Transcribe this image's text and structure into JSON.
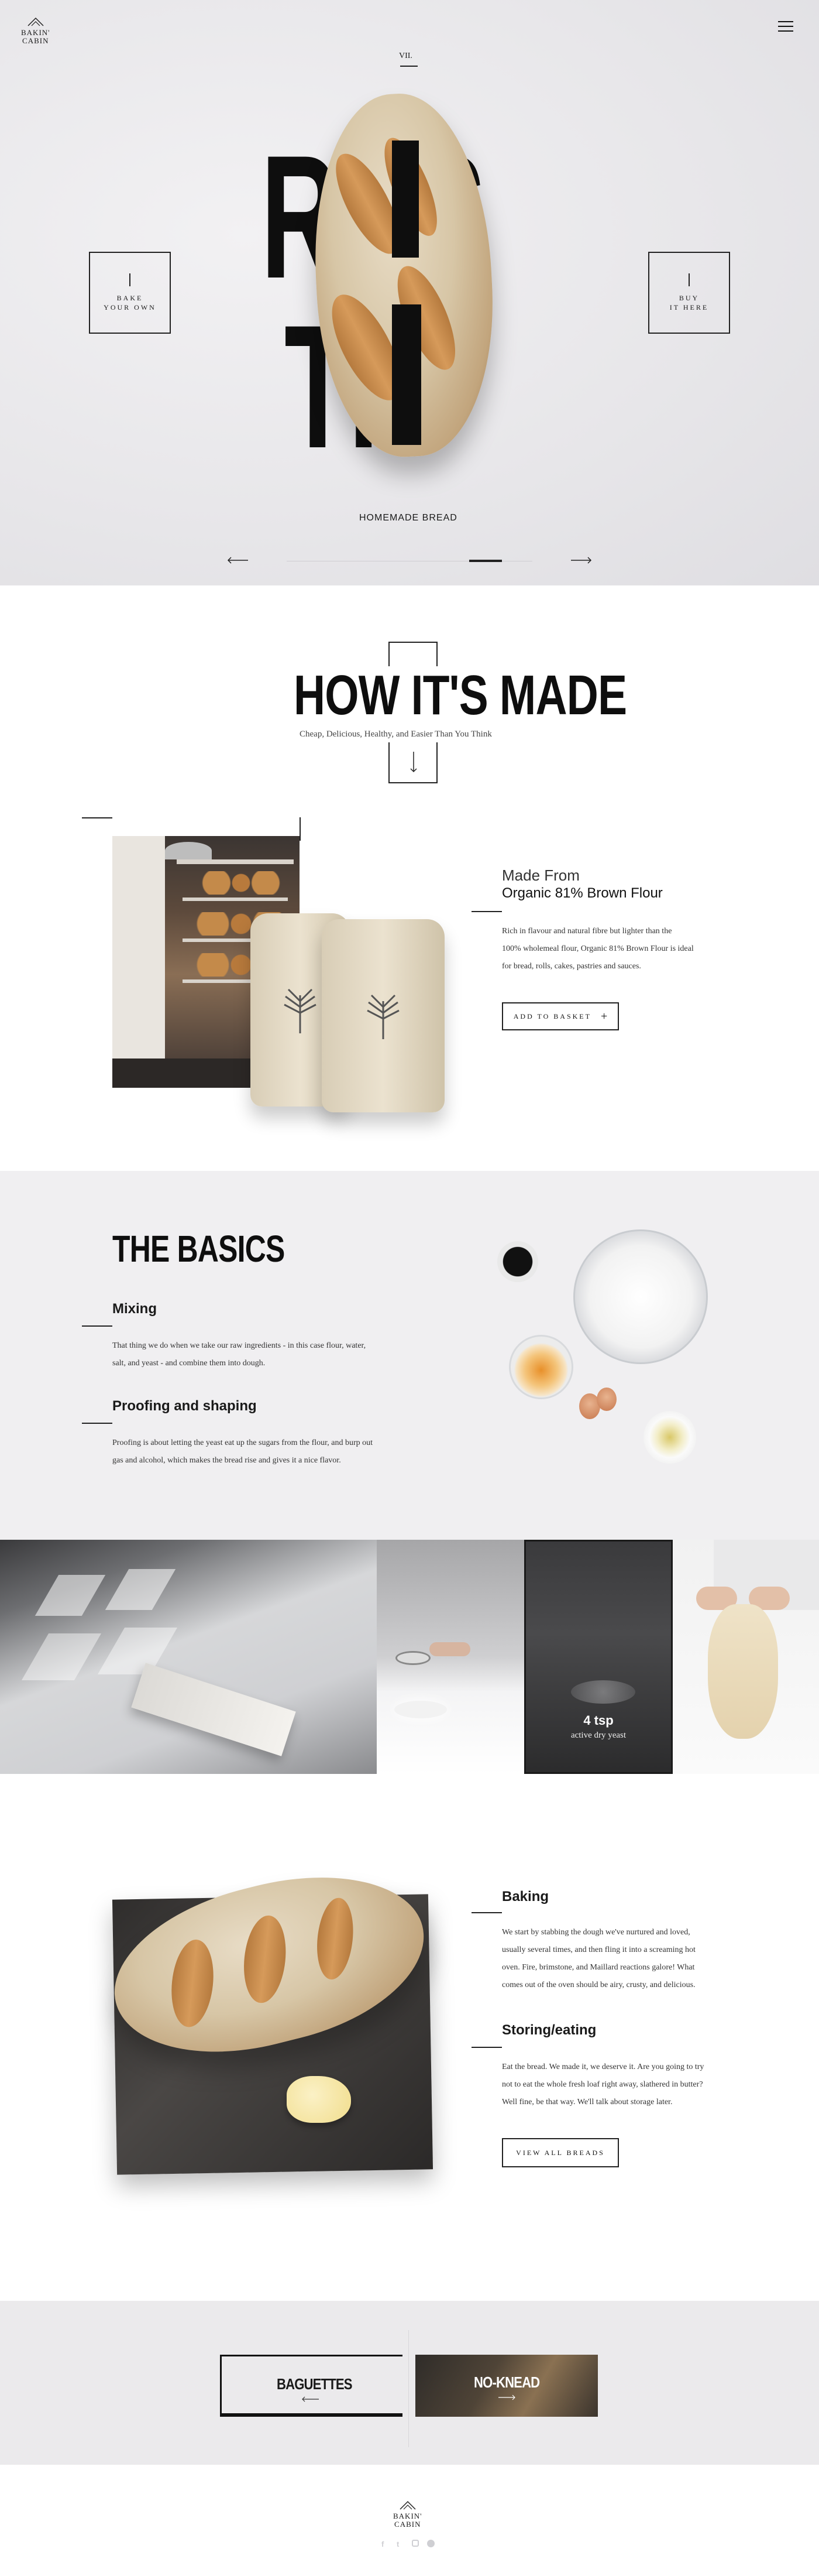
{
  "header": {
    "logo_line1": "BAKIN'",
    "logo_line2": "CABIN",
    "menu_icon": "hamburger-menu-icon"
  },
  "hero": {
    "slide_number": "VII.",
    "title_line1": "RUS",
    "title_line2": "TIC",
    "caption": "HOMEMADE BREAD",
    "left_box_line1": "BAKE",
    "left_box_line2": "YOUR OWN",
    "right_box_line1": "BUY",
    "right_box_line2": "IT HERE",
    "prev_icon": "arrow-left-icon",
    "next_icon": "arrow-right-icon"
  },
  "how": {
    "title": "HOW IT'S MADE",
    "subtitle": "Cheap, Delicious, Healthy, and Easier Than You Think",
    "down_icon": "arrow-down-icon",
    "made_from_label": "Made From",
    "flour_title": "Organic 81% Brown Flour",
    "flour_text_1": "Rich in flavour and natural fibre but lighter than the",
    "flour_text_2": "100% wholemeal flour, Organic 81% Brown Flour is ideal",
    "flour_text_3": "for bread, rolls, cakes, pastries and sauces.",
    "add_button": "ADD TO BASKET",
    "plus_icon": "+"
  },
  "basics": {
    "title": "THE BASICS",
    "mixing_title": "Mixing",
    "mixing_text_1": "That thing we do when we take our raw ingredients - in this case flour, water,",
    "mixing_text_2": "salt, and yeast - and combine them into dough.",
    "proofing_title": "Proofing and shaping",
    "proofing_text_1": "Proofing is about letting the yeast eat up the sugars from the flour, and burp out",
    "proofing_text_2": "gas and alcohol, which makes the bread rise and gives it a nice flavor."
  },
  "gallery": {
    "yeast_amount": "4 tsp",
    "yeast_label": "active dry yeast"
  },
  "baking": {
    "baking_title": "Baking",
    "baking_text_1": "We start by stabbing the dough we've nurtured and loved,",
    "baking_text_2": "usually several times, and then fling it into a screaming hot",
    "baking_text_3": "oven. Fire, brimstone, and Maillard reactions galore! What",
    "baking_text_4": "comes out of the oven should be airy, crusty, and delicious.",
    "storing_title": "Storing/eating",
    "storing_text_1": "Eat the bread. We made it, we deserve it. Are you going to try",
    "storing_text_2": "not to eat the whole fresh loaf right away, slathered in butter?",
    "storing_text_3": "Well fine, be that way. We'll talk about storage later.",
    "view_button": "VIEW ALL BREADS"
  },
  "bottom_nav": {
    "prev_label": "BAGUETTES",
    "next_label": "NO-KNEAD"
  },
  "footer": {
    "logo_line1": "BAKIN'",
    "logo_line2": "CABIN",
    "social_icons": [
      "facebook-icon",
      "twitter-icon",
      "instagram-icon",
      "pinterest-icon"
    ]
  }
}
